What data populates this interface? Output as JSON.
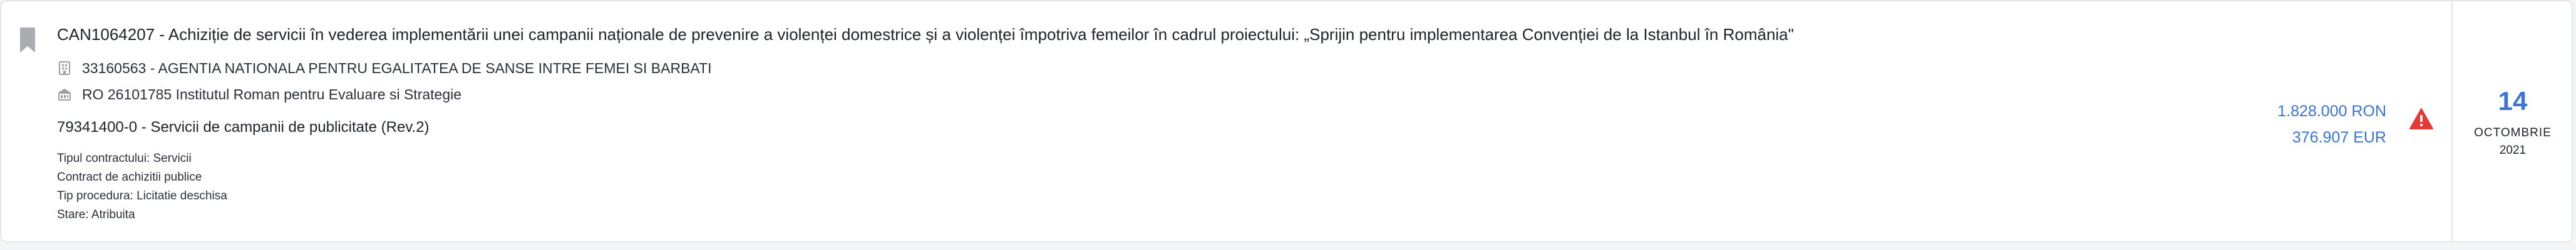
{
  "notice": {
    "title": "CAN1064207 - Achiziție de servicii în vederea implementării unei campanii naționale de prevenire a violenței domestrice și a violenței împotriva femeilor în cadrul proiectului: „Sprijin pentru implementarea Convenției de la Istanbul în România\"",
    "authority": "33160563 - AGENTIA NATIONALA PENTRU EGALITATEA DE SANSE INTRE FEMEI SI BARBATI",
    "winner": "RO 26101785 Institutul Roman pentru Evaluare si Strategie",
    "cpv": "79341400-0 - Servicii de campanii de publicitate (Rev.2)",
    "meta": {
      "contract_type": "Tipul contractului: Servicii",
      "contract_kind": "Contract de achizitii publice",
      "procedure": "Tip procedura: Licitatie deschisa",
      "status": "Stare: Atribuita"
    },
    "amount_ron": "1.828.000 RON",
    "amount_eur": "376.907 EUR",
    "date": {
      "day": "14",
      "month": "OCTOMBRIE",
      "year": "2021"
    }
  },
  "icons": {
    "bookmark": "bookmark-icon",
    "authority": "building-icon",
    "winner": "company-icon",
    "warning": "warning-icon"
  },
  "colors": {
    "accent": "#3a74d9",
    "warning": "#e53935",
    "bookmark": "#a9adb3"
  }
}
